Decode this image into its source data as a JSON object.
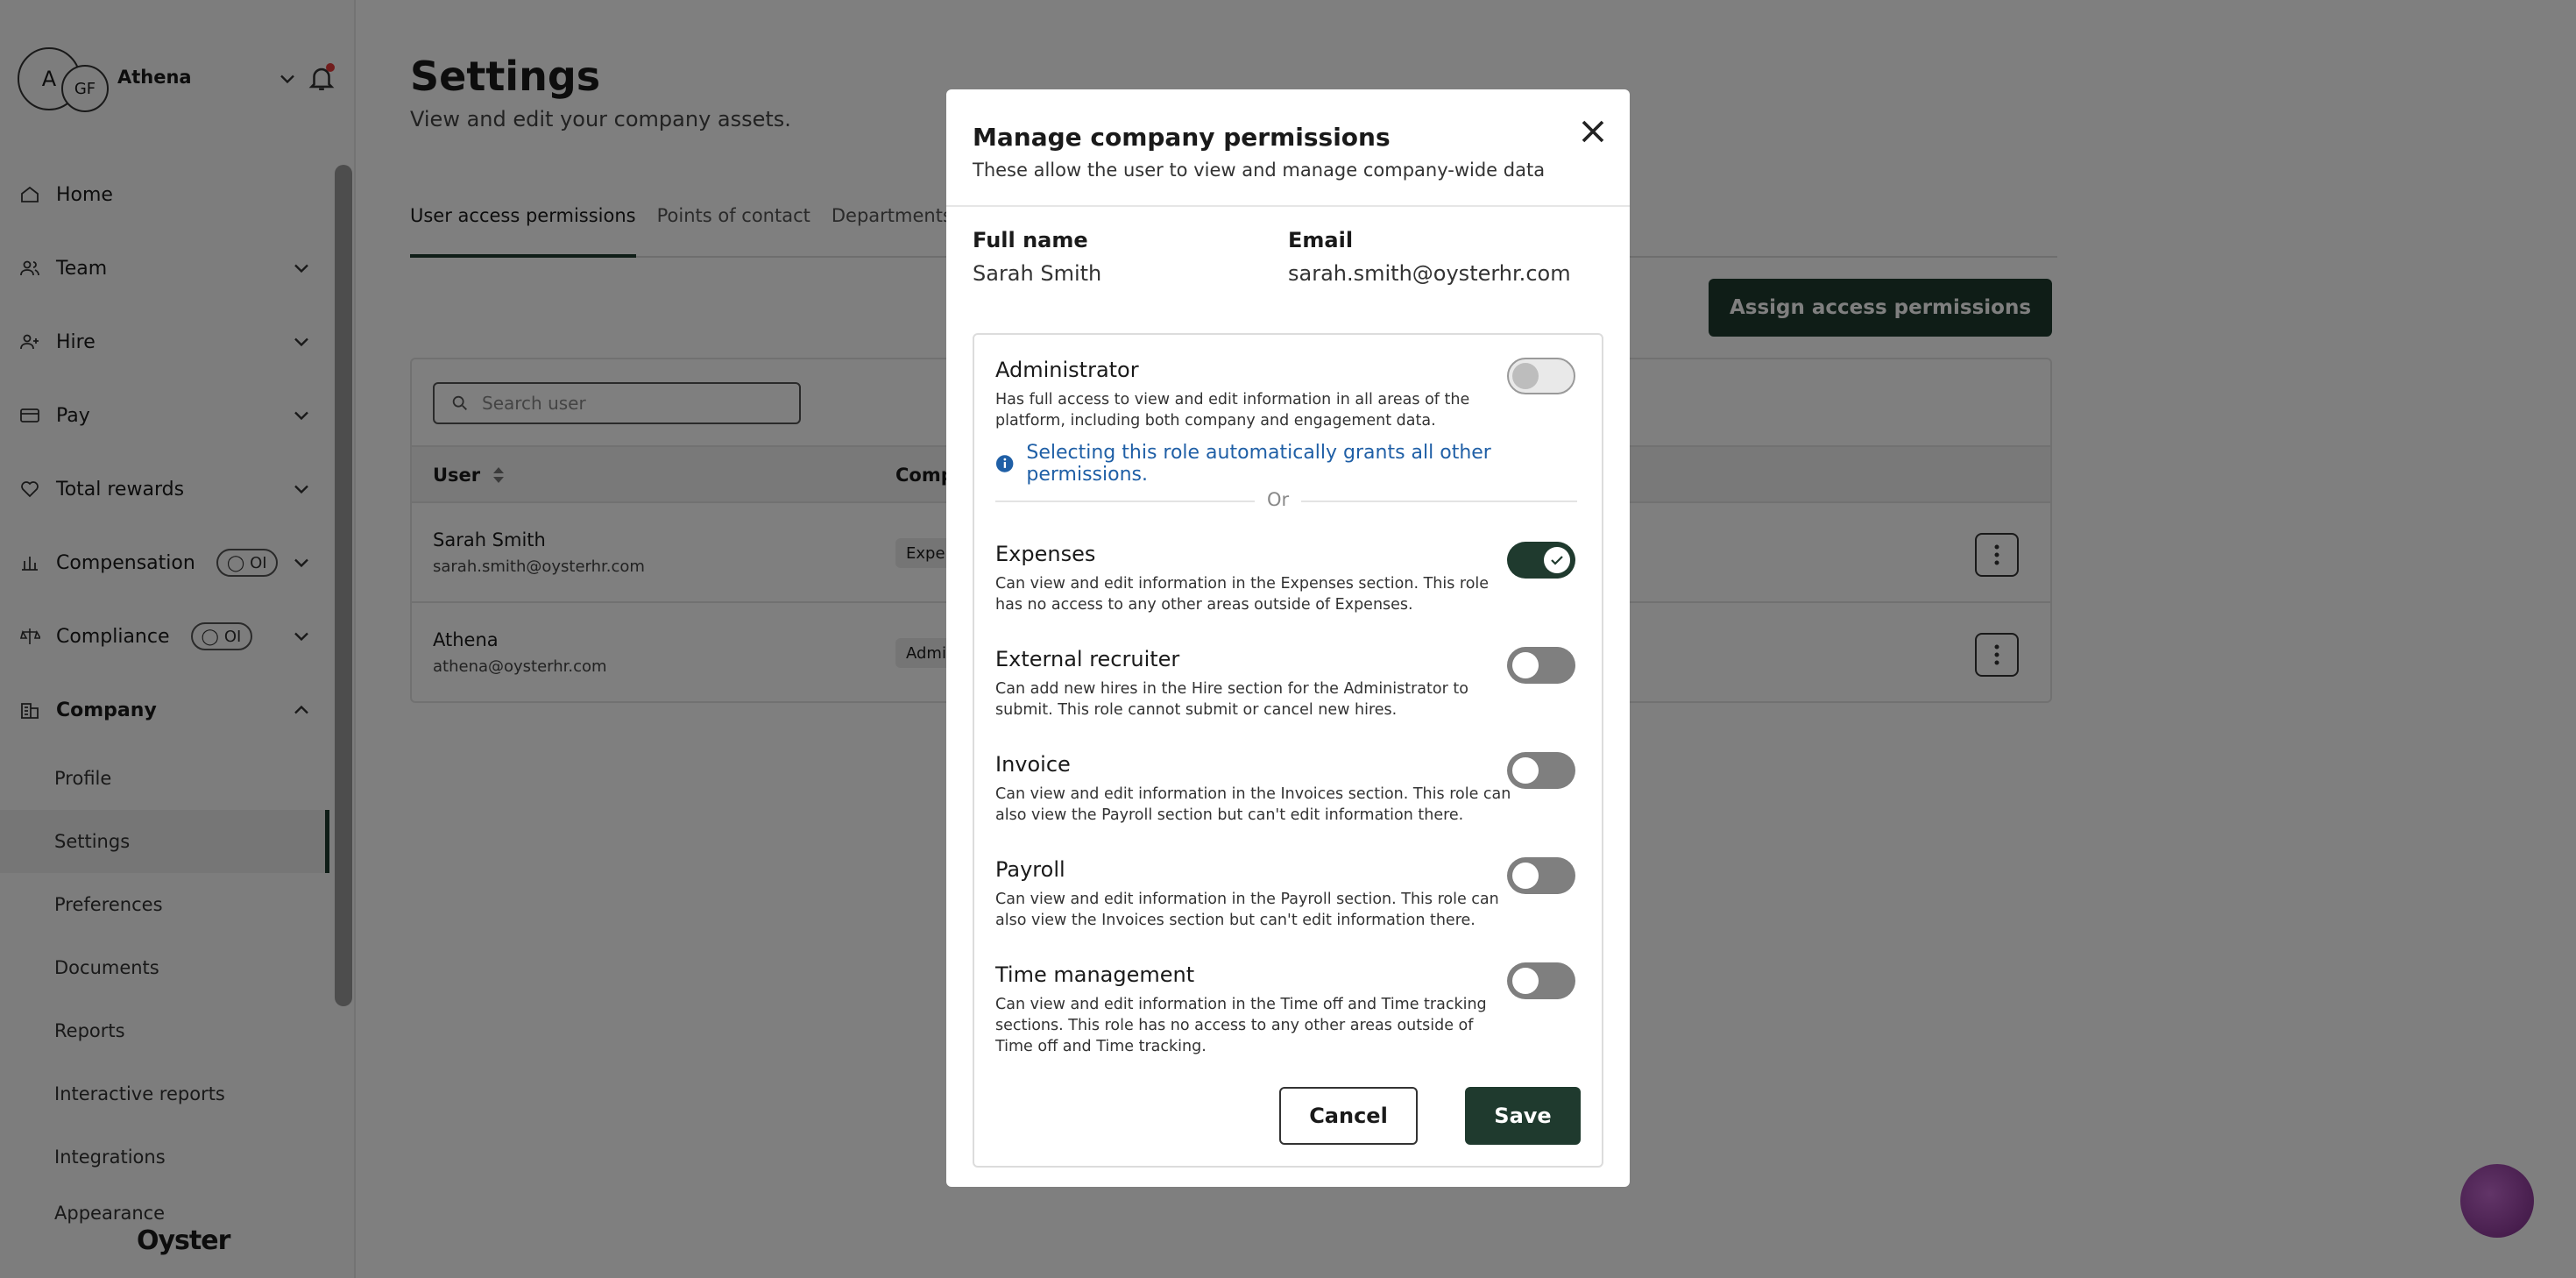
{
  "account": {
    "initial_a": "A",
    "initial_gf": "GF",
    "name": "Athena"
  },
  "sidebar": {
    "items": [
      {
        "label": "Home",
        "icon": "home-icon"
      },
      {
        "label": "Team",
        "icon": "team-icon"
      },
      {
        "label": "Hire",
        "icon": "hire-icon"
      },
      {
        "label": "Pay",
        "icon": "pay-icon"
      },
      {
        "label": "Total rewards",
        "icon": "heart-icon"
      },
      {
        "label": "Compensation",
        "icon": "scale-icon",
        "badge": "OI"
      },
      {
        "label": "Compliance",
        "icon": "compliance-icon",
        "badge": "OI"
      },
      {
        "label": "Company",
        "icon": "building-icon"
      }
    ],
    "company_sub": [
      "Profile",
      "Settings",
      "Preferences",
      "Documents",
      "Reports",
      "Interactive reports",
      "Integrations",
      "Appearance"
    ],
    "logo": "Oyster"
  },
  "page": {
    "title": "Settings",
    "subtitle": "View and edit your company assets.",
    "tabs": [
      "User access permissions",
      "Points of contact",
      "Departments"
    ],
    "assign_button": "Assign access permissions",
    "search_placeholder": "Search user",
    "columns": [
      "User",
      "Comp",
      ")"
    ],
    "rows": [
      {
        "name": "Sarah Smith",
        "email": "sarah.smith@oysterhr.com",
        "pill": "Expen"
      },
      {
        "name": "Athena",
        "email": "athena@oysterhr.com",
        "pill": "Admin"
      }
    ]
  },
  "modal": {
    "title": "Manage company permissions",
    "description": "These allow the user to view and manage company-wide data",
    "full_name_label": "Full name",
    "full_name": "Sarah Smith",
    "email_label": "Email",
    "email": "sarah.smith@oysterhr.com",
    "info": "Selecting this role automatically grants all other permissions.",
    "or": "Or",
    "permissions": [
      {
        "title": "Administrator",
        "desc": "Has full access to view and edit information in all areas of the platform, including both company and engagement data.",
        "state": "disabled"
      },
      {
        "title": "Expenses",
        "desc": "Can view and edit information in the Expenses section. This role has no access to any other areas outside of Expenses.",
        "state": "on"
      },
      {
        "title": "External recruiter",
        "desc": "Can add new hires in the Hire section for the Administrator to submit. This role cannot submit or cancel new hires.",
        "state": "off"
      },
      {
        "title": "Invoice",
        "desc": "Can view and edit information in the Invoices section. This role can also view the Payroll section but can't edit information there.",
        "state": "off"
      },
      {
        "title": "Payroll",
        "desc": "Can view and edit information in the Payroll section. This role can also view the Invoices section but can't edit information there.",
        "state": "off"
      },
      {
        "title": "Time management",
        "desc": "Can view and edit information in the Time off and Time tracking sections. This role has no access to any other areas outside of Time off and Time tracking.",
        "state": "off"
      }
    ],
    "cancel": "Cancel",
    "save": "Save"
  },
  "colors": {
    "brand": "#1f3a2e",
    "info": "#1f5fa6"
  }
}
